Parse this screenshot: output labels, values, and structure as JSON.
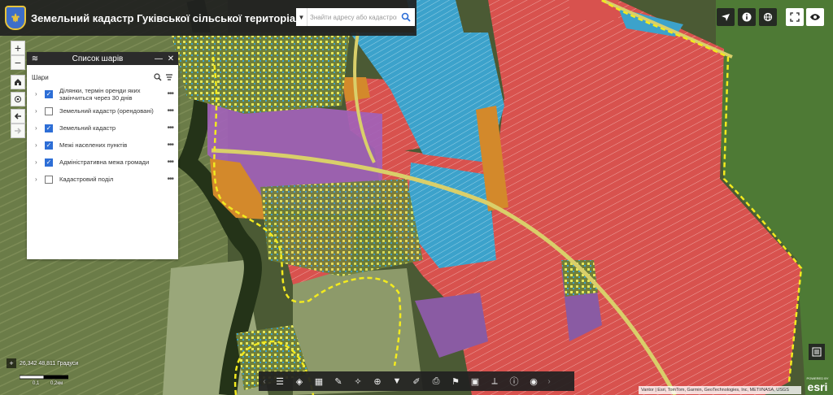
{
  "header": {
    "title": "Земельний кадастр Гуківської сільської територіальної громади",
    "search_placeholder": "Знайти адресу або кадастровий н"
  },
  "layer_panel": {
    "title": "Список шарів",
    "section_label": "Шари",
    "layers": [
      {
        "name": "Ділянки, термін оренди яких закінчиться через 30 днів",
        "checked": true
      },
      {
        "name": "Земельний кадастр (орендовані)",
        "checked": false
      },
      {
        "name": "Земельний кадастр",
        "checked": true
      },
      {
        "name": "Межі населених пунктів",
        "checked": true
      },
      {
        "name": "Адміністративна межа громади",
        "checked": true
      },
      {
        "name": "Кадастровий поділ",
        "checked": false
      }
    ]
  },
  "status": {
    "coordinates": "26,342 48,811 Градуси",
    "scale_left": "0,1",
    "scale_right": "0,2км"
  },
  "attribution": "Vantor | Esri, TomTom, Garmin, GeoTechnologies, Inc, METI/NASA, USGS",
  "esri": {
    "powered_by": "POWERED BY",
    "brand": "esri"
  },
  "colors": {
    "parcel_red": "#d9534f",
    "parcel_blue": "#3aa0c8",
    "parcel_purple": "#9a5fb3",
    "parcel_orange": "#d3892b",
    "settlement_yellow": "#e8e85a",
    "boundary_yellow": "#f2ea1f",
    "checkbox_blue": "#2d6ed6"
  }
}
